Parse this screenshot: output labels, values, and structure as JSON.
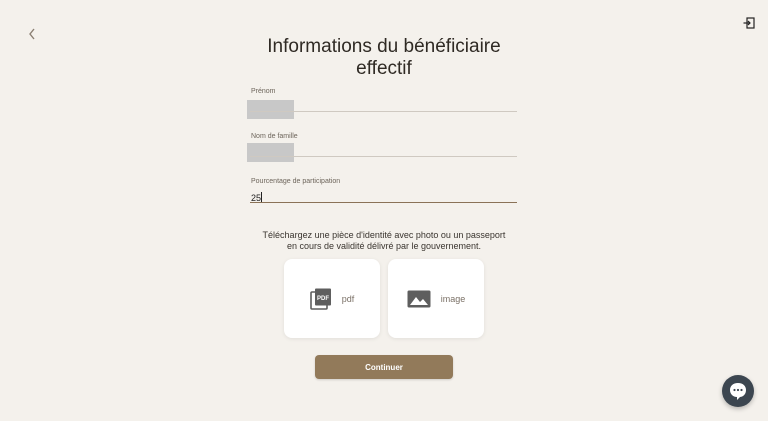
{
  "header": {
    "back_icon": "chevron-left-icon",
    "logout_icon": "logout-icon"
  },
  "page": {
    "title_line1": "Informations du bénéficiaire",
    "title_line2": "effectif"
  },
  "form": {
    "first_name": {
      "label": "Prénom",
      "value": ""
    },
    "last_name": {
      "label": "Nom de famille",
      "value": ""
    },
    "participation": {
      "label": "Pourcentage de participation",
      "value": "25"
    }
  },
  "upload": {
    "instructions_line1": "Téléchargez une pièce d'identité avec photo ou un passeport",
    "instructions_line2": "en cours de validité délivré par le gouvernement.",
    "pdf_label": "pdf",
    "image_label": "image"
  },
  "actions": {
    "continue_label": "Continuer"
  },
  "colors": {
    "background": "#f4f1ec",
    "accent": "#927a5a",
    "chat": "#3c4650"
  }
}
